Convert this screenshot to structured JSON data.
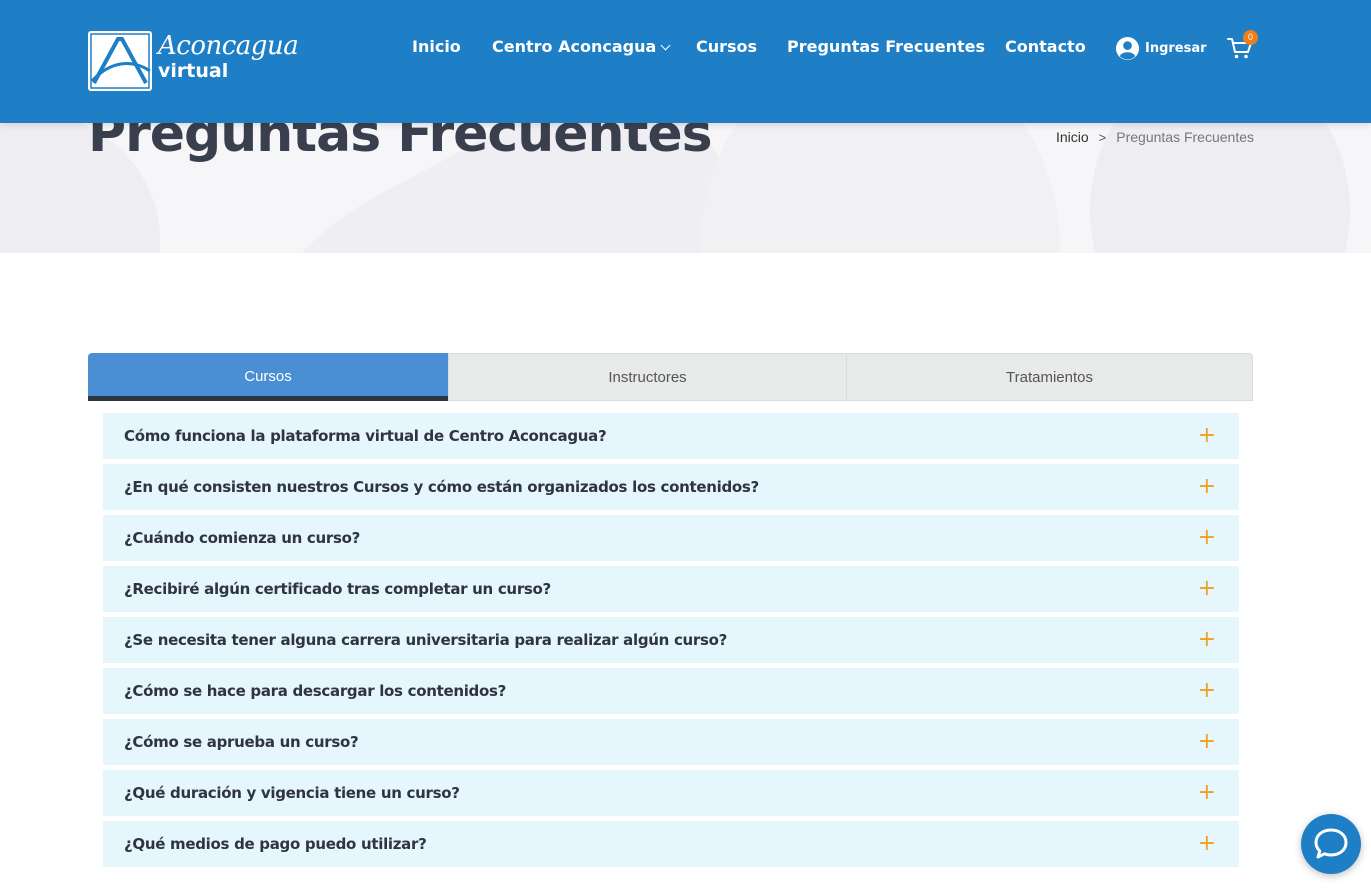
{
  "brand": {
    "name_script": "Aconcagua",
    "name_bold": "virtual",
    "header_color": "#1e7fc7",
    "accent_color": "#f0a020"
  },
  "nav": {
    "items": [
      {
        "label": "Inicio"
      },
      {
        "label": "Centro Aconcagua",
        "has_dropdown": true
      },
      {
        "label": "Cursos"
      },
      {
        "label": "Preguntas Frecuentes"
      },
      {
        "label": "Contacto"
      }
    ],
    "login_label": "Ingresar",
    "login_icon": "user-circle-icon",
    "cart_icon": "cart-icon",
    "cart_count": "0"
  },
  "hero": {
    "title": "Preguntas Frecuentes",
    "breadcrumb": {
      "home": "Inicio",
      "separator": ">",
      "current": "Preguntas Frecuentes"
    }
  },
  "tabs": [
    {
      "label": "Cursos",
      "active": true
    },
    {
      "label": "Instructores",
      "active": false
    },
    {
      "label": "Tratamientos",
      "active": false
    }
  ],
  "faq": {
    "expand_symbol": "+",
    "items": [
      {
        "question": "Cómo funciona la plataforma virtual de Centro Aconcagua?"
      },
      {
        "question": "¿En qué consisten nuestros Cursos y cómo están organizados los contenidos?"
      },
      {
        "question": "¿Cuándo comienza un curso?"
      },
      {
        "question": "¿Recibiré algún certificado tras completar un curso?"
      },
      {
        "question": "¿Se necesita tener alguna carrera universitaria para realizar algún curso?"
      },
      {
        "question": "¿Cómo se hace para descargar los contenidos?"
      },
      {
        "question": "¿Cómo se aprueba un curso?"
      },
      {
        "question": "¿Qué duración y vigencia tiene un curso?"
      },
      {
        "question": "¿Qué medios de pago puedo utilizar?"
      }
    ]
  },
  "chat": {
    "icon": "chat-bubble-icon"
  }
}
